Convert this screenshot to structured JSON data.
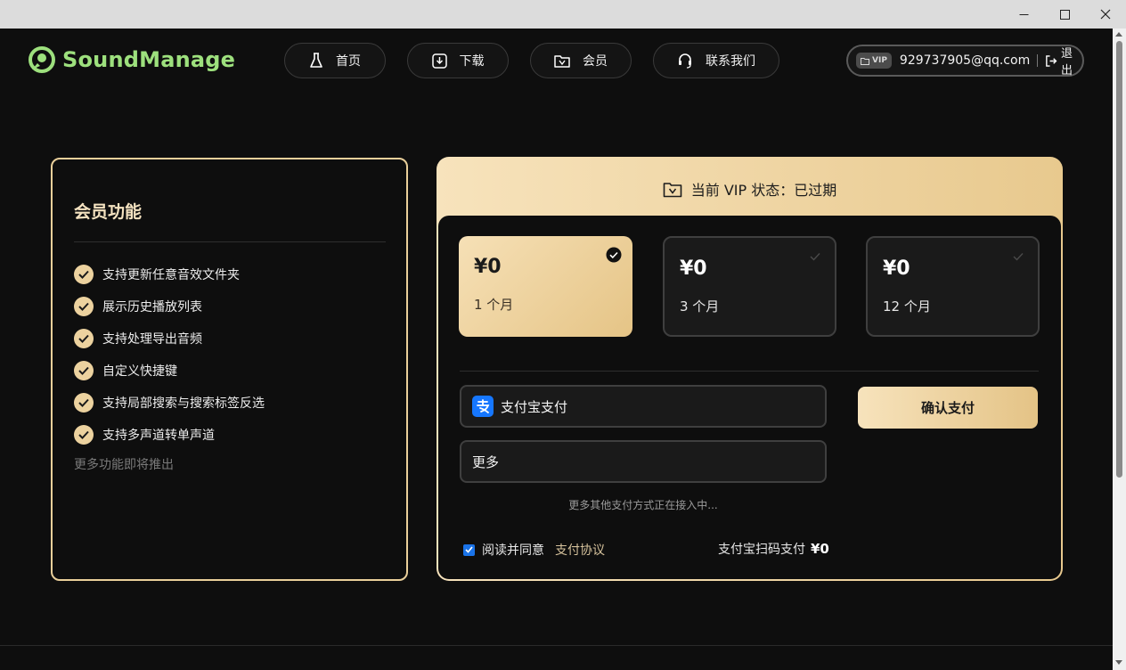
{
  "app": {
    "name": "SoundManage"
  },
  "nav": {
    "home": "首页",
    "download": "下载",
    "member": "会员",
    "contact": "联系我们"
  },
  "user": {
    "badge": "VIP",
    "email": "929737905@qq.com",
    "logout": "退出"
  },
  "features": {
    "title": "会员功能",
    "items": [
      "支持更新任意音效文件夹",
      "展示历史播放列表",
      "支持处理导出音频",
      "自定义快捷键",
      "支持局部搜索与搜索标签反选",
      "支持多声道转单声道"
    ],
    "more": "更多功能即将推出"
  },
  "status": {
    "text": "当前 VIP 状态：已过期"
  },
  "plans": [
    {
      "price": "¥0",
      "duration": "1 个月",
      "selected": true
    },
    {
      "price": "¥0",
      "duration": "3 个月",
      "selected": false
    },
    {
      "price": "¥0",
      "duration": "12 个月",
      "selected": false
    }
  ],
  "payment": {
    "alipay": "支付宝支付",
    "more": "更多",
    "note": "更多其他支付方式正在接入中...",
    "confirm": "确认支付",
    "agree_text": "阅读并同意",
    "agree_link": "支付协议",
    "agree_checked": true,
    "scan_label": "支付宝扫码支付",
    "scan_amount": "¥0"
  },
  "colors": {
    "accent_gold": "#e9cf9a",
    "brand_green": "#9de07d",
    "alipay_blue": "#1677ff"
  }
}
